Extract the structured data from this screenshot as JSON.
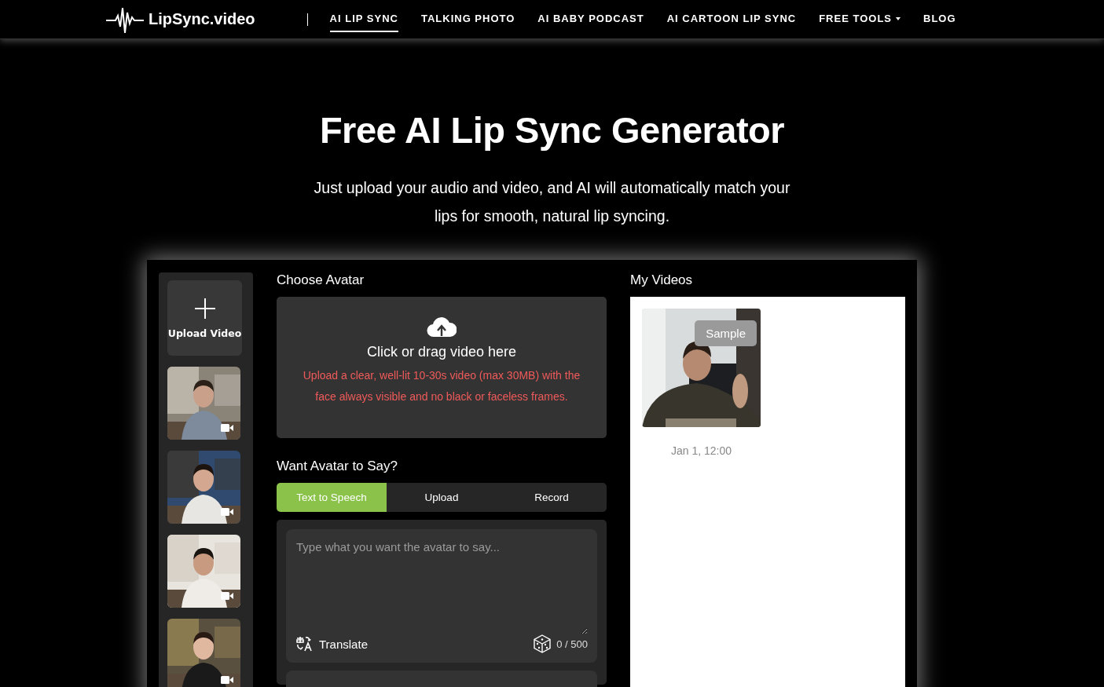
{
  "nav": {
    "logo": "LipSync.video",
    "items": [
      {
        "label": "AI LIP SYNC",
        "selected": true,
        "dropdown": false
      },
      {
        "label": "TALKING PHOTO",
        "selected": false,
        "dropdown": false
      },
      {
        "label": "AI BABY PODCAST",
        "selected": false,
        "dropdown": false
      },
      {
        "label": "AI CARTOON LIP SYNC",
        "selected": false,
        "dropdown": false
      },
      {
        "label": "FREE TOOLS",
        "selected": false,
        "dropdown": true
      },
      {
        "label": "BLOG",
        "selected": false,
        "dropdown": false
      }
    ]
  },
  "hero": {
    "title": "Free AI Lip Sync Generator",
    "subtitle": "Just upload your audio and video, and AI will automatically match your lips for smooth, natural lip syncing."
  },
  "sidebar": {
    "upload_label": "Upload Video"
  },
  "choose_avatar": {
    "heading": "Choose Avatar",
    "drop_title": "Click or drag video here",
    "drop_hint": "Upload a clear, well-lit 10-30s video (max 30MB) with the face always visible and no black or faceless frames."
  },
  "speech": {
    "heading": "Want Avatar to Say?",
    "tabs": [
      {
        "label": "Text to Speech",
        "selected": true
      },
      {
        "label": "Upload",
        "selected": false
      },
      {
        "label": "Record",
        "selected": false
      }
    ],
    "placeholder": "Type what you want the avatar to say...",
    "translate": "Translate",
    "counter": "0 / 500"
  },
  "my_videos": {
    "heading": "My Videos",
    "videos": [
      {
        "badge": "Sample",
        "date": "Jan 1, 12:00"
      }
    ]
  }
}
